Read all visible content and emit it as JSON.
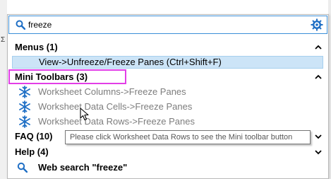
{
  "search": {
    "query": "freeze"
  },
  "categories": {
    "menus": {
      "label": "Menus (1)"
    },
    "mini_toolbars": {
      "label": "Mini Toolbars (3)"
    },
    "faq": {
      "label": "FAQ (10)"
    },
    "help": {
      "label": "Help (4)"
    }
  },
  "menu_results": [
    {
      "label": "View->Unfreeze/Freeze Panes (Ctrl+Shift+F)"
    }
  ],
  "mini_toolbar_results": [
    {
      "label": "Worksheet Columns->Freeze Panes"
    },
    {
      "label": "Worksheet Data Cells->Freeze Panes"
    },
    {
      "label": "Worksheet Data Rows->Freeze Panes"
    }
  ],
  "tooltip": {
    "text": "Please click Worksheet Data Rows to see the Mini toolbar button"
  },
  "web_search": {
    "label": "Web search \"freeze\""
  },
  "colors": {
    "accent": "#1f6fc5",
    "highlight": "#cce4f7",
    "callout_box": "#e23ee7",
    "dimmed_text": "#7d7d7d"
  }
}
